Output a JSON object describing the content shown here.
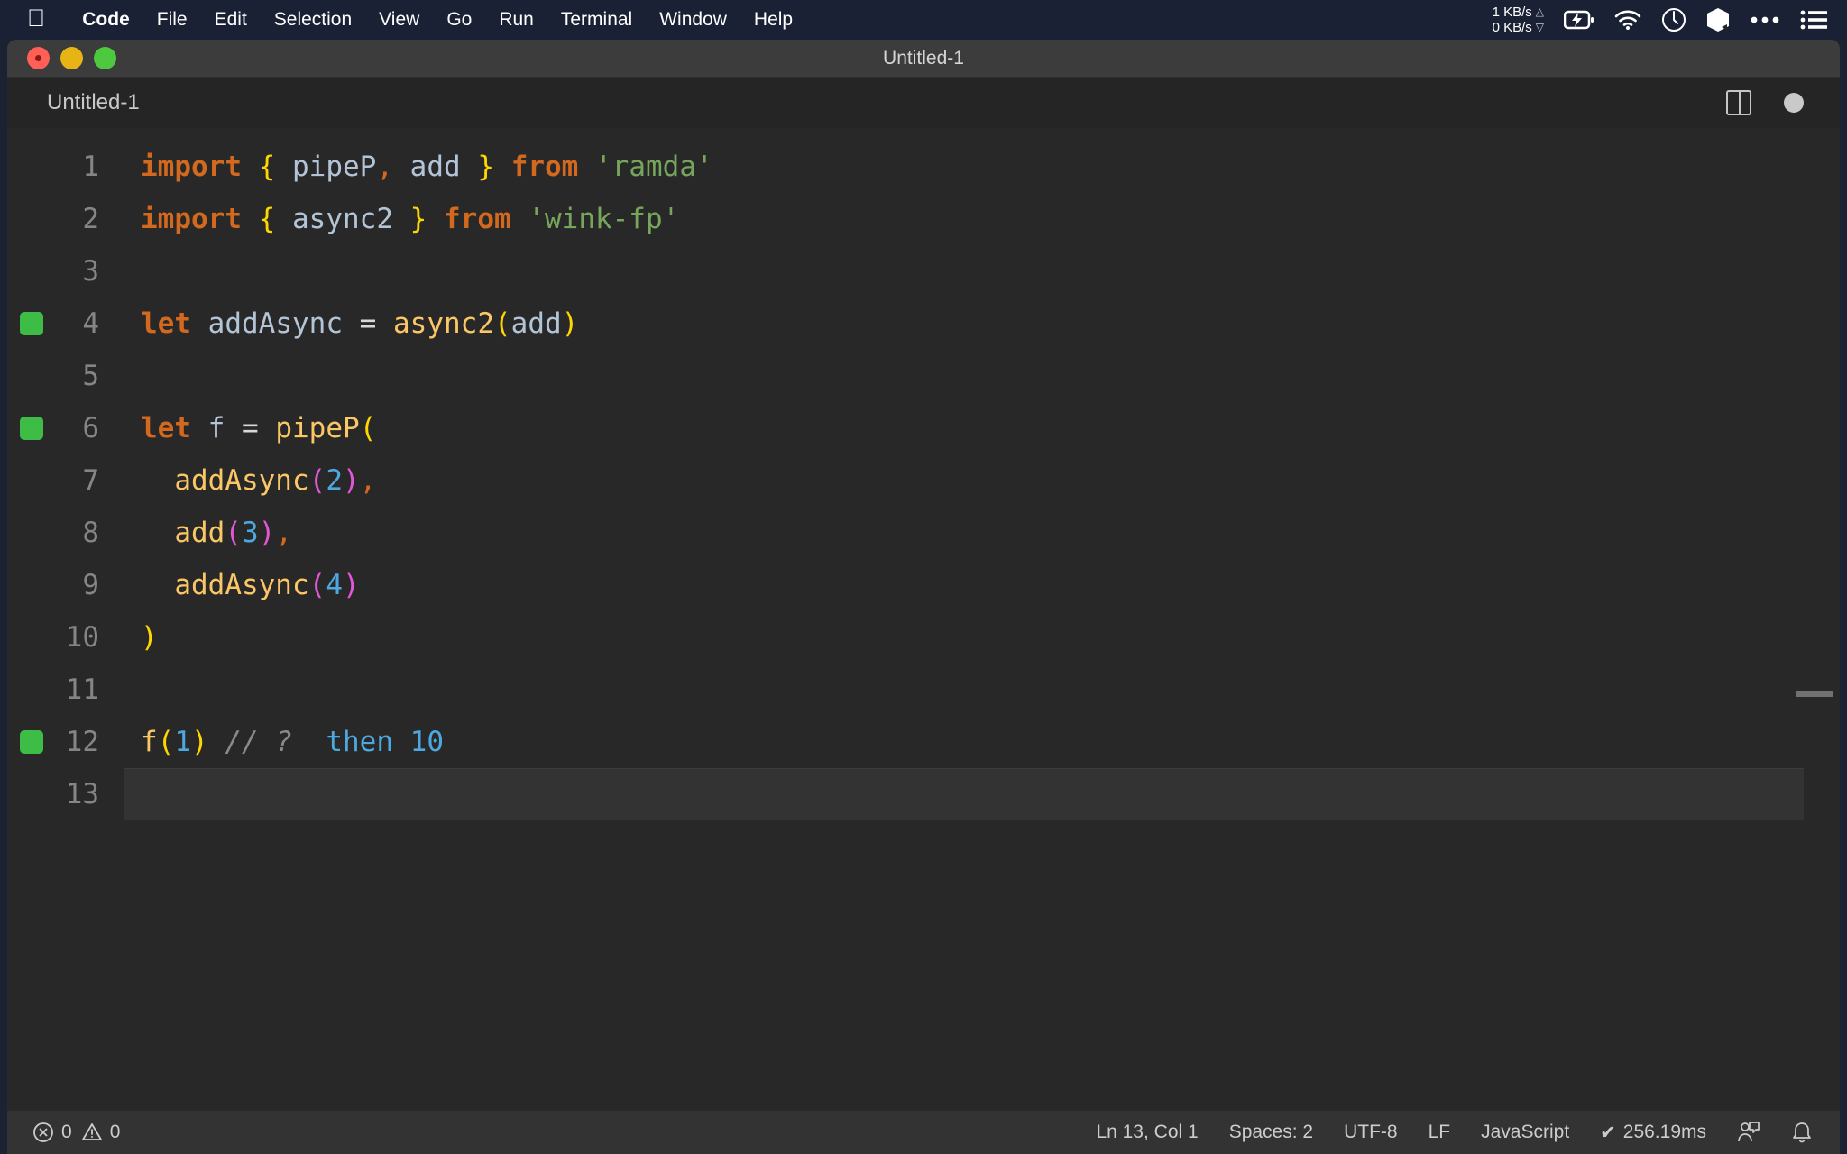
{
  "menubar": {
    "apple_icon": "apple-logo-icon",
    "items": [
      {
        "label": "Code",
        "bold": true
      },
      {
        "label": "File",
        "bold": false
      },
      {
        "label": "Edit",
        "bold": false
      },
      {
        "label": "Selection",
        "bold": false
      },
      {
        "label": "View",
        "bold": false
      },
      {
        "label": "Go",
        "bold": false
      },
      {
        "label": "Run",
        "bold": false
      },
      {
        "label": "Terminal",
        "bold": false
      },
      {
        "label": "Window",
        "bold": false
      },
      {
        "label": "Help",
        "bold": false
      }
    ],
    "network": {
      "upload": "1 KB/s",
      "download": "0 KB/s"
    },
    "status_icons": [
      "battery-charging-icon",
      "wifi-icon",
      "clock-icon",
      "cube-icon",
      "ellipsis-icon",
      "list-menu-icon"
    ]
  },
  "window": {
    "title": "Untitled-1",
    "traffic_lights": [
      "close-button",
      "minimize-button",
      "maximize-button"
    ]
  },
  "tabbar": {
    "tab_label": "Untitled-1",
    "split_editor_icon": "split-editor-icon",
    "dirty_indicator": "unsaved-dot-icon"
  },
  "editor": {
    "language_mode": "JavaScript",
    "lines": [
      {
        "n": "1",
        "mark": false,
        "active": false,
        "tokens": [
          {
            "t": "import",
            "c": "kw"
          },
          {
            "t": " ",
            "c": "op"
          },
          {
            "t": "{",
            "c": "brace"
          },
          {
            "t": " ",
            "c": "op"
          },
          {
            "t": "pipeP",
            "c": "ident"
          },
          {
            "t": ",",
            "c": "punct"
          },
          {
            "t": " ",
            "c": "op"
          },
          {
            "t": "add",
            "c": "ident"
          },
          {
            "t": " ",
            "c": "op"
          },
          {
            "t": "}",
            "c": "brace"
          },
          {
            "t": " ",
            "c": "op"
          },
          {
            "t": "from",
            "c": "kw"
          },
          {
            "t": " ",
            "c": "op"
          },
          {
            "t": "'ramda'",
            "c": "str"
          }
        ]
      },
      {
        "n": "2",
        "mark": false,
        "active": false,
        "tokens": [
          {
            "t": "import",
            "c": "kw"
          },
          {
            "t": " ",
            "c": "op"
          },
          {
            "t": "{",
            "c": "brace"
          },
          {
            "t": " ",
            "c": "op"
          },
          {
            "t": "async2",
            "c": "ident"
          },
          {
            "t": " ",
            "c": "op"
          },
          {
            "t": "}",
            "c": "brace"
          },
          {
            "t": " ",
            "c": "op"
          },
          {
            "t": "from",
            "c": "kw"
          },
          {
            "t": " ",
            "c": "op"
          },
          {
            "t": "'wink-fp'",
            "c": "str"
          }
        ]
      },
      {
        "n": "3",
        "mark": false,
        "active": false,
        "tokens": []
      },
      {
        "n": "4",
        "mark": true,
        "active": false,
        "tokens": [
          {
            "t": "let",
            "c": "kw"
          },
          {
            "t": " ",
            "c": "op"
          },
          {
            "t": "addAsync",
            "c": "ident"
          },
          {
            "t": " ",
            "c": "op"
          },
          {
            "t": "=",
            "c": "op"
          },
          {
            "t": " ",
            "c": "op"
          },
          {
            "t": "async2",
            "c": "fn"
          },
          {
            "t": "(",
            "c": "paren1"
          },
          {
            "t": "add",
            "c": "ident"
          },
          {
            "t": ")",
            "c": "paren1"
          }
        ]
      },
      {
        "n": "5",
        "mark": false,
        "active": false,
        "tokens": []
      },
      {
        "n": "6",
        "mark": true,
        "active": false,
        "tokens": [
          {
            "t": "let",
            "c": "kw"
          },
          {
            "t": " ",
            "c": "op"
          },
          {
            "t": "f",
            "c": "ident"
          },
          {
            "t": " ",
            "c": "op"
          },
          {
            "t": "=",
            "c": "op"
          },
          {
            "t": " ",
            "c": "op"
          },
          {
            "t": "pipeP",
            "c": "fn"
          },
          {
            "t": "(",
            "c": "paren1"
          }
        ]
      },
      {
        "n": "7",
        "mark": false,
        "active": false,
        "tokens": [
          {
            "t": "  ",
            "c": "op"
          },
          {
            "t": "addAsync",
            "c": "fn"
          },
          {
            "t": "(",
            "c": "paren2"
          },
          {
            "t": "2",
            "c": "num"
          },
          {
            "t": ")",
            "c": "paren2"
          },
          {
            "t": ",",
            "c": "punct"
          }
        ]
      },
      {
        "n": "8",
        "mark": false,
        "active": false,
        "tokens": [
          {
            "t": "  ",
            "c": "op"
          },
          {
            "t": "add",
            "c": "fn"
          },
          {
            "t": "(",
            "c": "paren2"
          },
          {
            "t": "3",
            "c": "num"
          },
          {
            "t": ")",
            "c": "paren2"
          },
          {
            "t": ",",
            "c": "punct"
          }
        ]
      },
      {
        "n": "9",
        "mark": false,
        "active": false,
        "tokens": [
          {
            "t": "  ",
            "c": "op"
          },
          {
            "t": "addAsync",
            "c": "fn"
          },
          {
            "t": "(",
            "c": "paren2"
          },
          {
            "t": "4",
            "c": "num"
          },
          {
            "t": ")",
            "c": "paren2"
          }
        ]
      },
      {
        "n": "10",
        "mark": false,
        "active": false,
        "tokens": [
          {
            "t": ")",
            "c": "paren1"
          }
        ]
      },
      {
        "n": "11",
        "mark": false,
        "active": false,
        "tokens": []
      },
      {
        "n": "12",
        "mark": true,
        "active": false,
        "tokens": [
          {
            "t": "f",
            "c": "fn"
          },
          {
            "t": "(",
            "c": "paren1"
          },
          {
            "t": "1",
            "c": "num"
          },
          {
            "t": ")",
            "c": "paren1"
          },
          {
            "t": " ",
            "c": "op"
          },
          {
            "t": "// ?",
            "c": "comment"
          },
          {
            "t": "  ",
            "c": "op"
          },
          {
            "t": "then 10",
            "c": "quokka"
          }
        ]
      },
      {
        "n": "13",
        "mark": false,
        "active": true,
        "tokens": []
      }
    ]
  },
  "statusbar": {
    "errors": "0",
    "warnings": "0",
    "cursor": "Ln 13, Col 1",
    "indentation": "Spaces: 2",
    "encoding": "UTF-8",
    "eol": "LF",
    "language": "JavaScript",
    "run_time": "256.19ms",
    "run_check": "✔",
    "feedback_icon": "feedback-person-icon",
    "bell_icon": "notification-bell-icon"
  },
  "colors": {
    "menubar_bg": "#1b2135",
    "titlebar_bg": "#3c3c3c",
    "editor_bg": "#282828",
    "statusbar_bg": "#333333",
    "keyword": "#d2691e",
    "string": "#76a65c",
    "function": "#fbc665",
    "number": "#4ea8e0",
    "bracket_level1": "#ffd700",
    "bracket_level2": "#e356d8",
    "comment": "#8a8a8a",
    "gutter_mark": "#3dbd46"
  }
}
